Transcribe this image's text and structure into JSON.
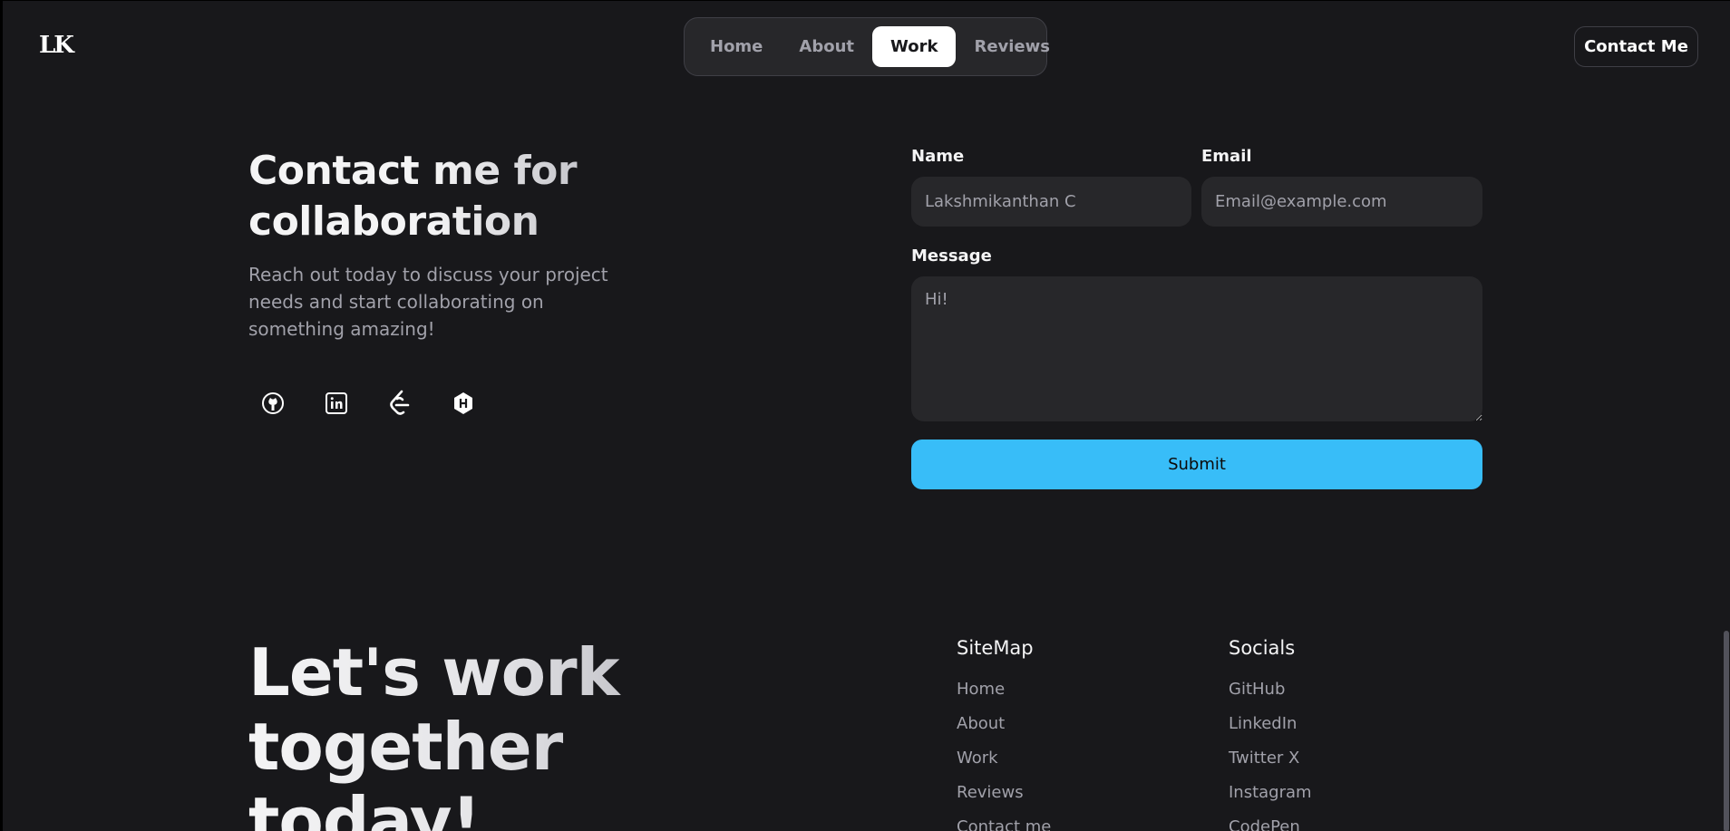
{
  "header": {
    "logo": "LK",
    "nav": [
      {
        "label": "Home",
        "active": false
      },
      {
        "label": "About",
        "active": false
      },
      {
        "label": "Work",
        "active": true
      },
      {
        "label": "Reviews",
        "active": false
      }
    ],
    "contact_button": "Contact Me"
  },
  "contact": {
    "title": "Contact me for collaboration",
    "description": "Reach out today to discuss your project needs and start collaborating on something amazing!",
    "social_icons": [
      "github-icon",
      "linkedin-icon",
      "leetcode-icon",
      "hackerrank-icon"
    ]
  },
  "form": {
    "name_label": "Name",
    "name_placeholder": "Lakshmikanthan C",
    "email_label": "Email",
    "email_placeholder": "Email@example.com",
    "message_label": "Message",
    "message_placeholder": "Hi!",
    "submit_label": "Submit"
  },
  "footer": {
    "title": "Let's work together today!",
    "sitemap_heading": "SiteMap",
    "sitemap": [
      "Home",
      "About",
      "Work",
      "Reviews",
      "Contact me"
    ],
    "socials_heading": "Socials",
    "socials": [
      "GitHub",
      "LinkedIn",
      "Twitter X",
      "Instagram",
      "CodePen"
    ]
  },
  "colors": {
    "background": "#18181b",
    "surface": "#27272a",
    "accent": "#38bdf8",
    "muted_text": "#a1a1aa"
  }
}
